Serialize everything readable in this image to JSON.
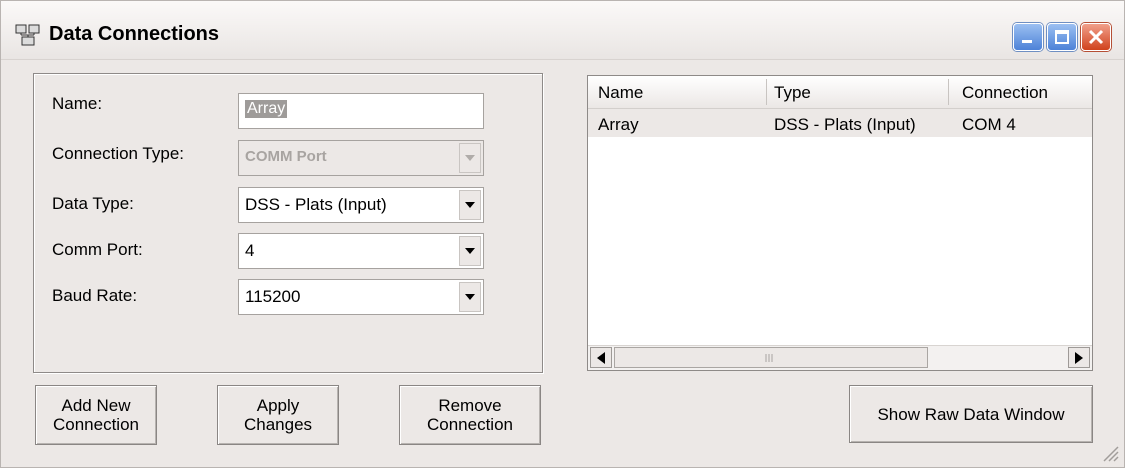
{
  "window": {
    "title": "Data Connections",
    "icons": {
      "app": "network-connections-icon",
      "minimize": "minimize-icon",
      "maximize": "maximize-icon",
      "close": "close-icon"
    },
    "colors": {
      "window_bg": "#ece8e6",
      "close_button": "#d0421d",
      "title_buttons": "#4d82d8"
    }
  },
  "form": {
    "name": {
      "label": "Name:",
      "value": "Array"
    },
    "connection_type": {
      "label": "Connection Type:",
      "value": "COMM Port",
      "disabled": true
    },
    "data_type": {
      "label": "Data Type:",
      "value": "DSS - Plats (Input)"
    },
    "comm_port": {
      "label": "Comm Port:",
      "value": "4"
    },
    "baud_rate": {
      "label": "Baud Rate:",
      "value": "115200"
    }
  },
  "buttons": {
    "add": {
      "line1": "Add New",
      "line2": "Connection"
    },
    "apply": {
      "line1": "Apply",
      "line2": "Changes"
    },
    "remove": {
      "line1": "Remove",
      "line2": "Connection"
    },
    "raw": "Show Raw Data Window"
  },
  "list": {
    "columns": [
      "Name",
      "Type",
      "Connection"
    ],
    "rows": [
      {
        "name": "Array",
        "type": "DSS - Plats (Input)",
        "connection": "COM 4",
        "selected": true
      }
    ]
  }
}
